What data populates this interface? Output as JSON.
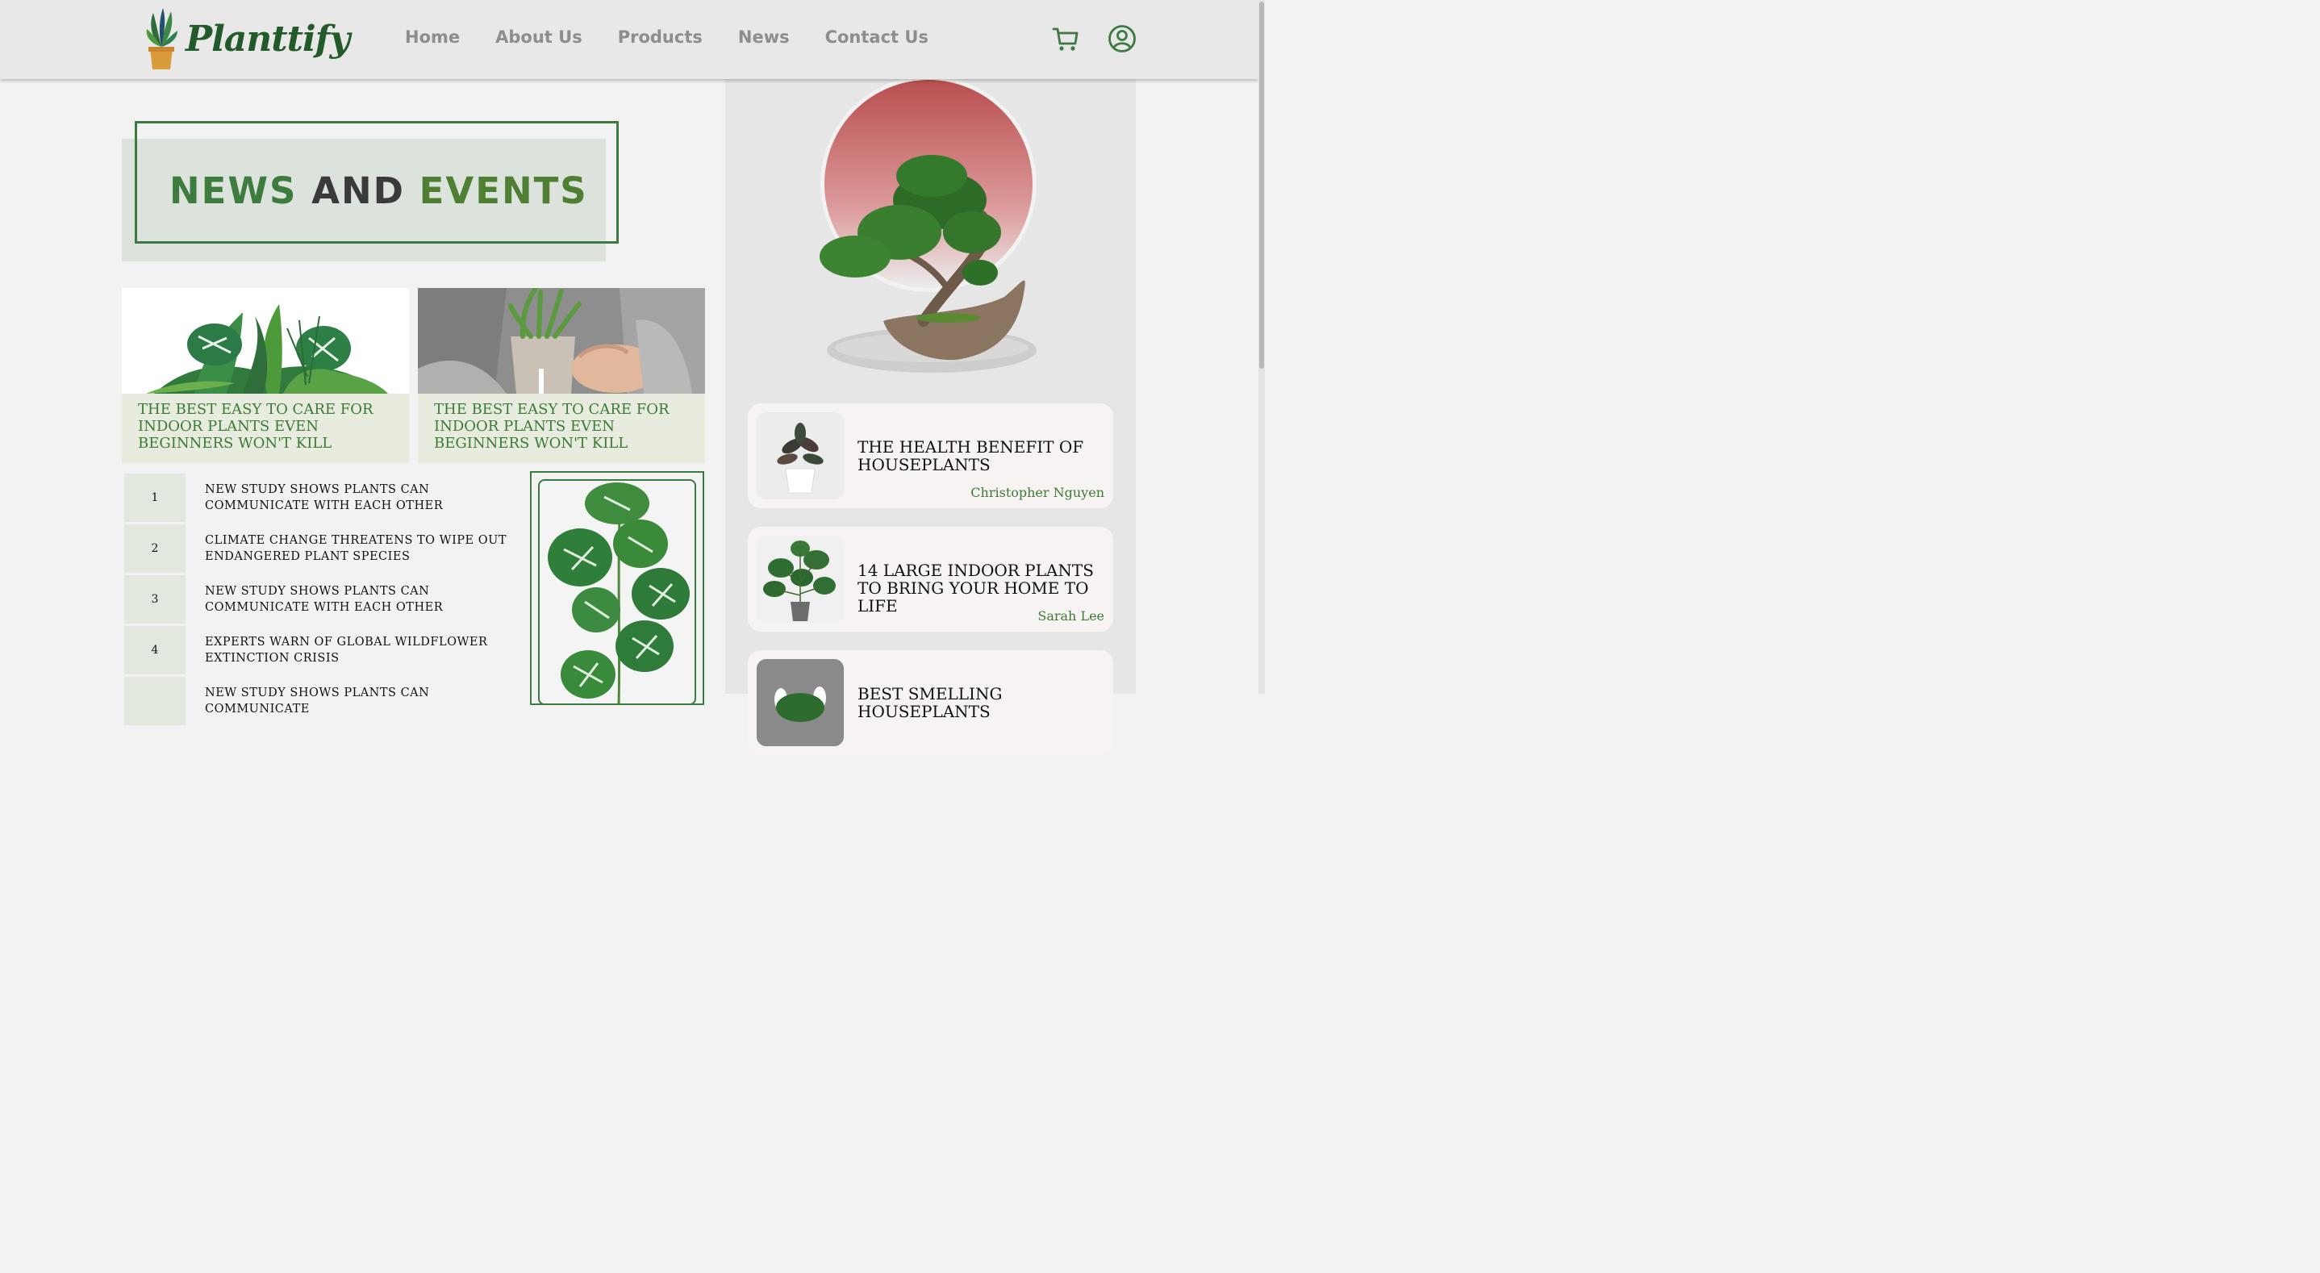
{
  "brand": {
    "name": "Planttify"
  },
  "nav": {
    "items": [
      "Home",
      "About Us",
      "Products",
      "News",
      "Contact Us"
    ]
  },
  "header_icons": [
    "cart-icon",
    "user-icon"
  ],
  "colors": {
    "accent": "#3d7a41",
    "nav_text": "#8d8d8d",
    "caption_bg": "#e7ecdf",
    "hero_circle": "#c05a5a"
  },
  "title": {
    "word1": "NEWS",
    "word2": "AND",
    "word3": "EVENTS"
  },
  "cards": [
    {
      "caption": "THE BEST EASY TO CARE FOR INDOOR PLANTS EVEN BEGINNERS WON'T KILL"
    },
    {
      "caption": "THE BEST EASY TO CARE FOR INDOOR PLANTS EVEN BEGINNERS WON'T KILL"
    }
  ],
  "news_list": [
    {
      "num": "1",
      "text": "NEW STUDY SHOWS PLANTS CAN COMMUNICATE WITH EACH OTHER"
    },
    {
      "num": "2",
      "text": "CLIMATE CHANGE THREATENS TO WIPE OUT ENDANGERED PLANT SPECIES"
    },
    {
      "num": "3",
      "text": "NEW STUDY SHOWS PLANTS CAN COMMUNICATE WITH EACH OTHER"
    },
    {
      "num": "4",
      "text": "EXPERTS WARN OF GLOBAL WILDFLOWER EXTINCTION CRISIS"
    },
    {
      "num": "",
      "text": "NEW STUDY SHOWS PLANTS CAN COMMUNICATE"
    }
  ],
  "side_articles": [
    {
      "title": "THE HEALTH BENEFIT OF HOUSEPLANTS",
      "author": "Christopher Nguyen"
    },
    {
      "title": "14 LARGE INDOOR PLANTS TO BRING YOUR HOME TO LIFE",
      "author": "Sarah Lee"
    },
    {
      "title": "BEST SMELLING HOUSEPLANTS",
      "author": ""
    }
  ]
}
